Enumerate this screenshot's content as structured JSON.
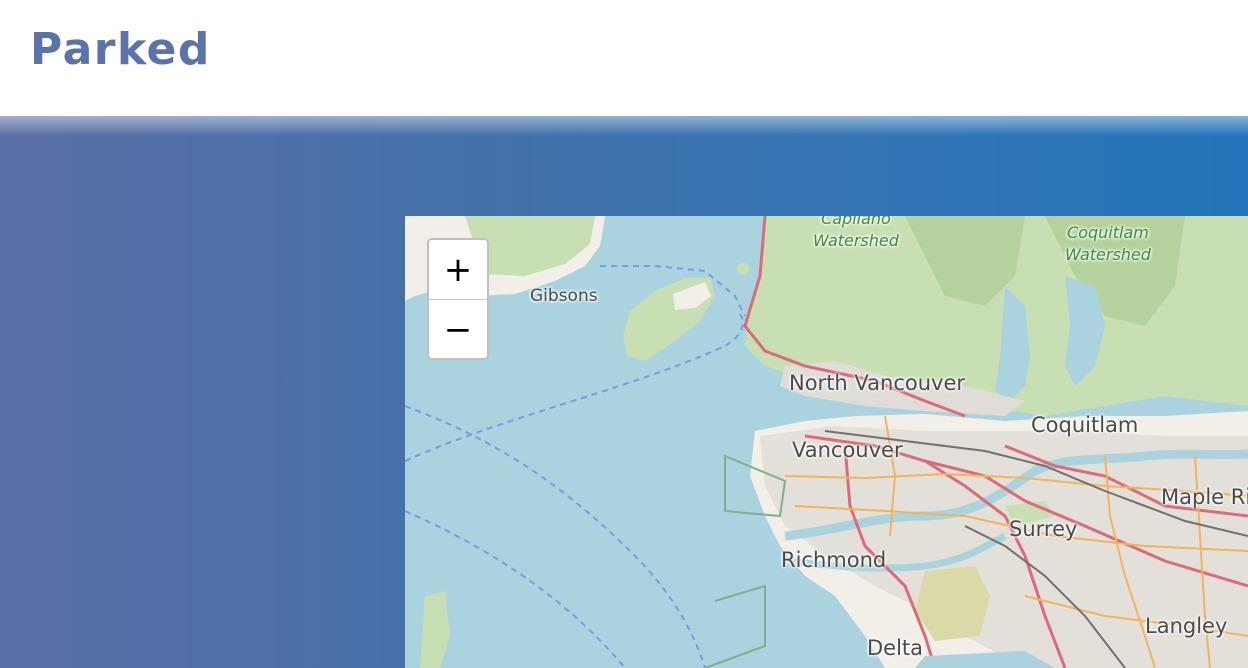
{
  "page": {
    "title": "Parked"
  },
  "map": {
    "zoom_in_label": "+",
    "zoom_out_label": "−",
    "labels": {
      "gibsons": "Gibsons",
      "north_vancouver": "North Vancouver",
      "vancouver": "Vancouver",
      "coquitlam": "Coquitlam",
      "maple_ridge": "Maple Ridge",
      "surrey": "Surrey",
      "richmond": "Richmond",
      "langley": "Langley",
      "delta": "Delta",
      "capilano_line1": "Capilano",
      "capilano_line2": "Watershed",
      "coquitlam_ws_line1": "Coquitlam",
      "coquitlam_ws_line2": "Watershed"
    }
  },
  "colors": {
    "title": "#5b73ab",
    "banner_left": "#5a6ea6",
    "banner_right": "#2474bb",
    "water": "#aad3df",
    "land": "#f2efe9",
    "forest": "#c8dfb4",
    "urban": "#e0ddd8",
    "major_road": "#dc6b7a",
    "secondary_road": "#f2b35b"
  }
}
